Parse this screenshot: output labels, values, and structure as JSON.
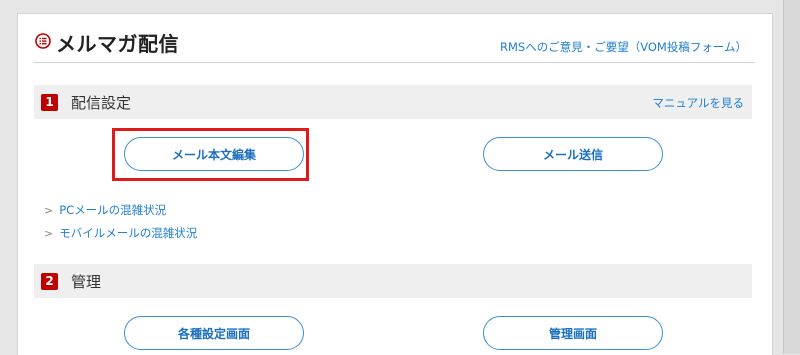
{
  "header": {
    "title": "メルマガ配信",
    "feedback_link": "RMSへのご意見・ご要望（VOM投稿フォーム）",
    "title_icon": "list-circle-icon"
  },
  "sections": [
    {
      "number": "1",
      "title": "配信設定",
      "manual_link": "マニュアルを見る",
      "buttons": [
        "メール本文編集",
        "メール送信"
      ],
      "links": [
        "PCメールの混雑状況",
        "モバイルメールの混雑状況"
      ]
    },
    {
      "number": "2",
      "title": "管理",
      "buttons": [
        "各種設定画面",
        "管理画面"
      ]
    }
  ],
  "colors": {
    "accent_red": "#bf0000",
    "link_blue": "#1f7fd1",
    "highlight": "#e01a1a"
  }
}
